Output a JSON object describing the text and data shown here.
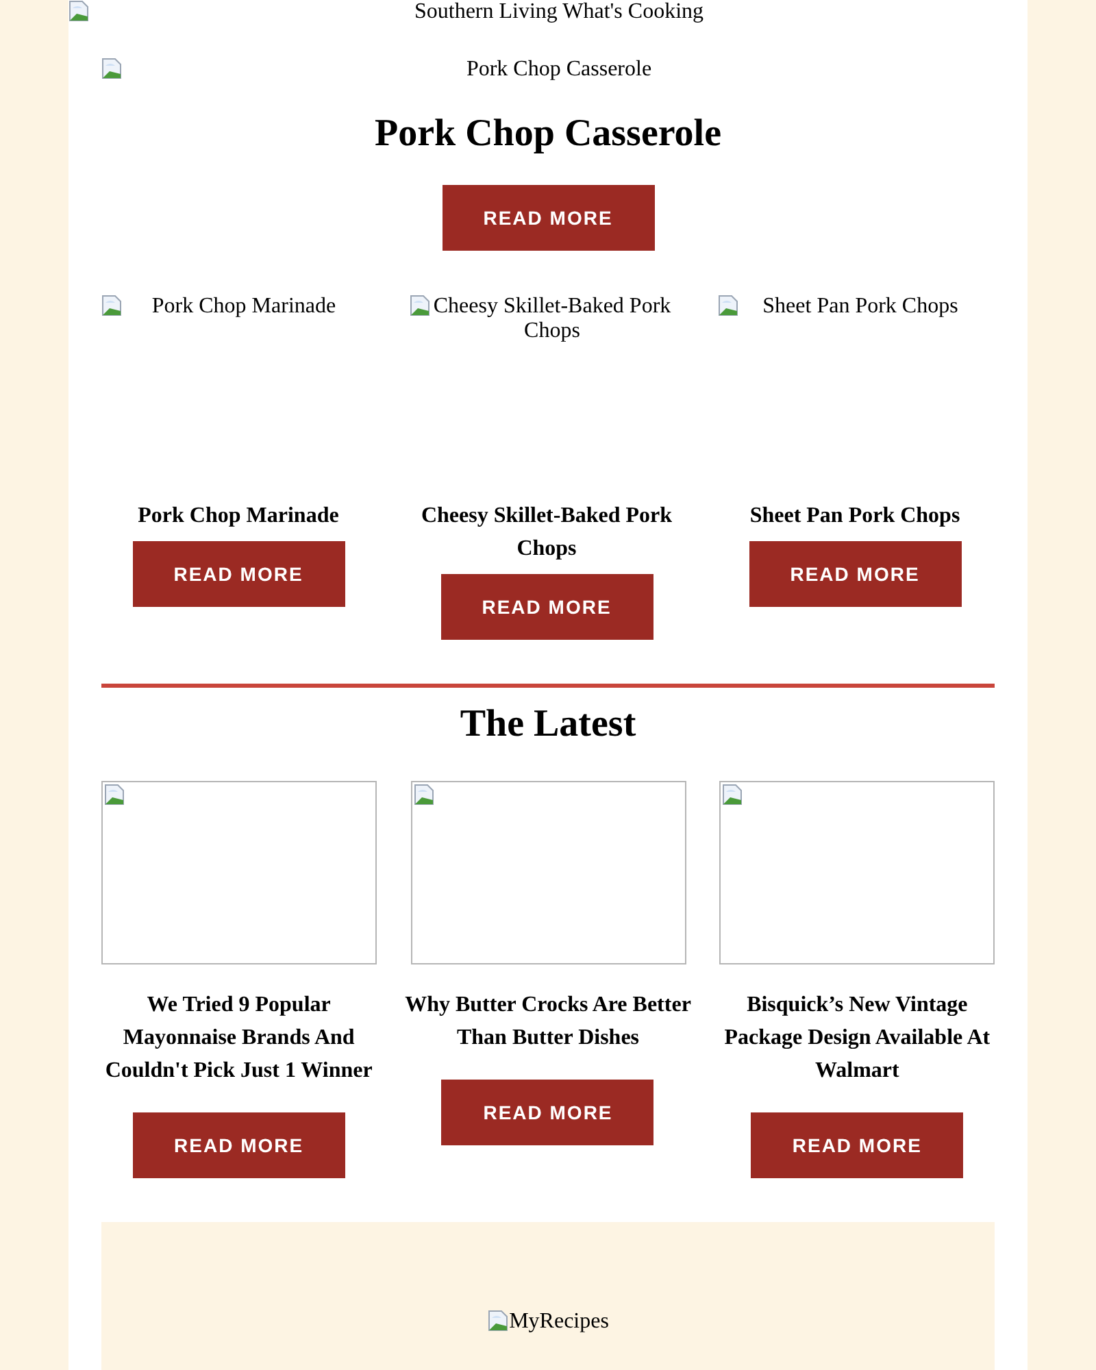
{
  "header_image": {
    "alt": "Southern Living What's Cooking"
  },
  "featured": {
    "image_alt": "Pork Chop Casserole",
    "title": "Pork Chop Casserole",
    "button": "READ MORE"
  },
  "related": [
    {
      "image_alt": "Pork Chop Marinade",
      "title": "Pork Chop Marinade",
      "button": "READ MORE"
    },
    {
      "image_alt": "Cheesy Skillet-Baked Pork Chops",
      "title": "Cheesy Skillet-Baked Pork Chops",
      "button": "READ MORE"
    },
    {
      "image_alt": "Sheet Pan Pork Chops",
      "title": "Sheet Pan Pork Chops",
      "button": "READ MORE"
    }
  ],
  "latest": {
    "heading": "The Latest",
    "items": [
      {
        "title": "We Tried 9 Popular Mayonnaise Brands And Couldn't Pick Just 1 Winner",
        "button": "READ MORE"
      },
      {
        "title": "Why Butter Crocks Are Better Than Butter Dishes",
        "button": "READ MORE"
      },
      {
        "title": "Bisquick’s New Vintage Package Design Available At Walmart",
        "button": "READ MORE"
      }
    ]
  },
  "footer": {
    "logo_alt": "MyRecipes"
  }
}
